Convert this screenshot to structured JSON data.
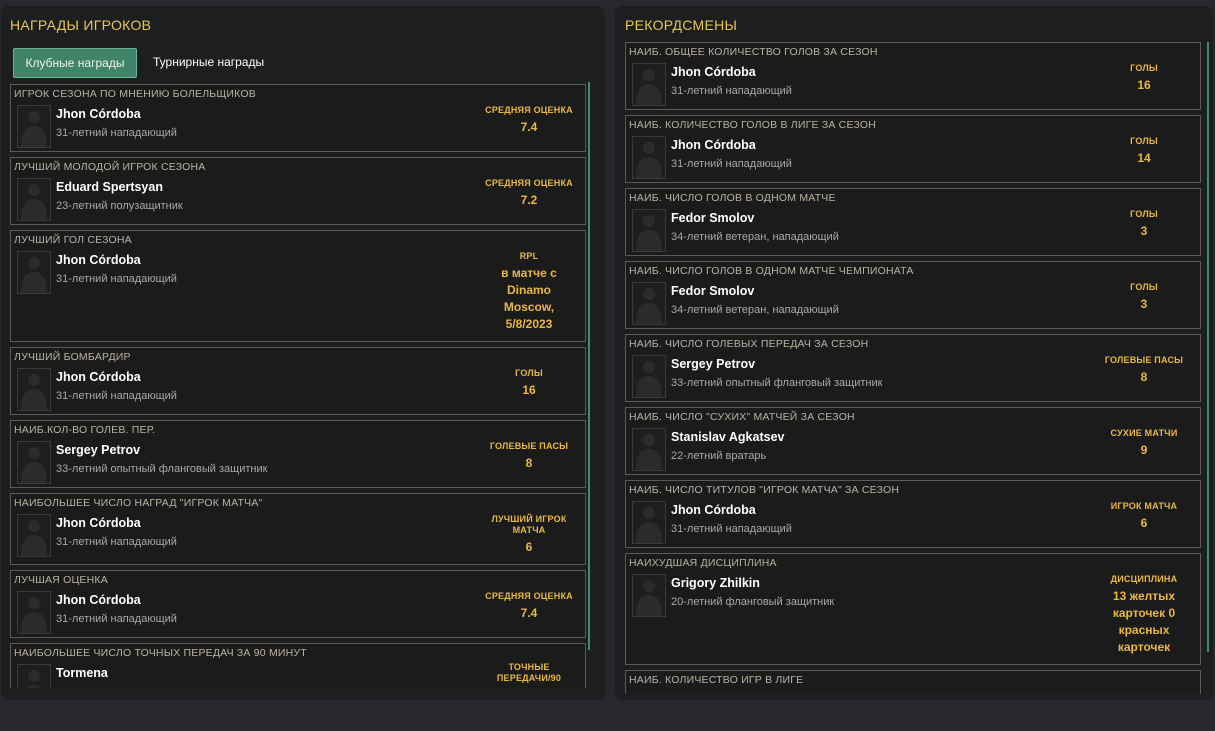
{
  "awards": {
    "title": "НАГРАДЫ ИГРОКОВ",
    "tabs": [
      {
        "label": "Клубные награды",
        "active": true
      },
      {
        "label": "Турнирные награды",
        "active": false
      }
    ],
    "items": [
      {
        "title": "ИГРОК СЕЗОНА ПО МНЕНИЮ БОЛЕЛЬЩИКОВ",
        "player": "Jhon Córdoba",
        "desc": "31-летний нападающий",
        "stat_label": "СРЕДНЯЯ ОЦЕНКА",
        "stat_value": "7.4"
      },
      {
        "title": "ЛУЧШИЙ МОЛОДОЙ ИГРОК СЕЗОНА",
        "player": "Eduard Spertsyan",
        "desc": "23-летний полузащитник",
        "stat_label": "СРЕДНЯЯ ОЦЕНКА",
        "stat_value": "7.2"
      },
      {
        "title": "ЛУЧШИЙ ГОЛ СЕЗОНА",
        "player": "Jhon Córdoba",
        "desc": "31-летний нападающий",
        "stat_label": "RPL",
        "stat_value": "в матче с Dinamo Moscow, 5/8/2023"
      },
      {
        "title": "ЛУЧШИЙ БОМБАРДИР",
        "player": "Jhon Córdoba",
        "desc": "31-летний нападающий",
        "stat_label": "ГОЛЫ",
        "stat_value": "16"
      },
      {
        "title": "НАИБ.КОЛ-ВО ГОЛЕВ. ПЕР.",
        "player": "Sergey Petrov",
        "desc": "33-летний опытный фланговый защитник",
        "stat_label": "ГОЛЕВЫЕ ПАСЫ",
        "stat_value": "8"
      },
      {
        "title": "НАИБОЛЬШЕЕ ЧИСЛО НАГРАД \"ИГРОК МАТЧА\"",
        "player": "Jhon Córdoba",
        "desc": "31-летний нападающий",
        "stat_label": "ЛУЧШИЙ ИГРОК МАТЧА",
        "stat_value": "6"
      },
      {
        "title": "ЛУЧШАЯ ОЦЕНКА",
        "player": "Jhon Córdoba",
        "desc": "31-летний нападающий",
        "stat_label": "СРЕДНЯЯ ОЦЕНКА",
        "stat_value": "7.4"
      },
      {
        "title": "НАИБОЛЬШЕЕ ЧИСЛО ТОЧНЫХ ПЕРЕДАЧ ЗА 90 МИНУТ",
        "player": "Tormena",
        "desc": "",
        "stat_label": "ТОЧНЫЕ ПЕРЕДАЧИ/90",
        "stat_value": ""
      }
    ]
  },
  "records": {
    "title": "РЕКОРДСМЕНЫ",
    "items": [
      {
        "title": "НАИБ. ОБЩЕЕ КОЛИЧЕСТВО ГОЛОВ ЗА СЕЗОН",
        "player": "Jhon Córdoba",
        "desc": "31-летний нападающий",
        "stat_label": "ГОЛЫ",
        "stat_value": "16"
      },
      {
        "title": "НАИБ. КОЛИЧЕСТВО ГОЛОВ В ЛИГЕ ЗА СЕЗОН",
        "player": "Jhon Córdoba",
        "desc": "31-летний нападающий",
        "stat_label": "ГОЛЫ",
        "stat_value": "14"
      },
      {
        "title": "НАИБ. ЧИСЛО ГОЛОВ В ОДНОМ МАТЧЕ",
        "player": "Fedor Smolov",
        "desc": "34-летний ветеран, нападающий",
        "stat_label": "ГОЛЫ",
        "stat_value": "3"
      },
      {
        "title": "НАИБ. ЧИСЛО ГОЛОВ В ОДНОМ МАТЧЕ ЧЕМПИОНАТА",
        "player": "Fedor Smolov",
        "desc": "34-летний ветеран, нападающий",
        "stat_label": "ГОЛЫ",
        "stat_value": "3"
      },
      {
        "title": "НАИБ. ЧИСЛО ГОЛЕВЫХ ПЕРЕДАЧ ЗА СЕЗОН",
        "player": "Sergey Petrov",
        "desc": "33-летний опытный фланговый защитник",
        "stat_label": "ГОЛЕВЫЕ ПАСЫ",
        "stat_value": "8"
      },
      {
        "title": "НАИБ. ЧИСЛО \"СУХИХ\" МАТЧЕЙ ЗА СЕЗОН",
        "player": "Stanislav Agkatsev",
        "desc": "22-летний вратарь",
        "stat_label": "СУХИЕ МАТЧИ",
        "stat_value": "9"
      },
      {
        "title": "НАИБ. ЧИСЛО ТИТУЛОВ \"ИГРОК МАТЧА\" ЗА СЕЗОН",
        "player": "Jhon Córdoba",
        "desc": "31-летний нападающий",
        "stat_label": "ИГРОК МАТЧА",
        "stat_value": "6"
      },
      {
        "title": "НАИХУДШАЯ ДИСЦИПЛИНА",
        "player": "Grigory Zhilkin",
        "desc": "20-летний фланговый защитник",
        "stat_label": "ДИСЦИПЛИНА",
        "stat_value": "13 желтых карточек 0 красных карточек"
      },
      {
        "title": "НАИБ. КОЛИЧЕСТВО ИГР В ЛИГЕ",
        "player": "",
        "desc": "",
        "stat_label": "",
        "stat_value": ""
      }
    ]
  }
}
